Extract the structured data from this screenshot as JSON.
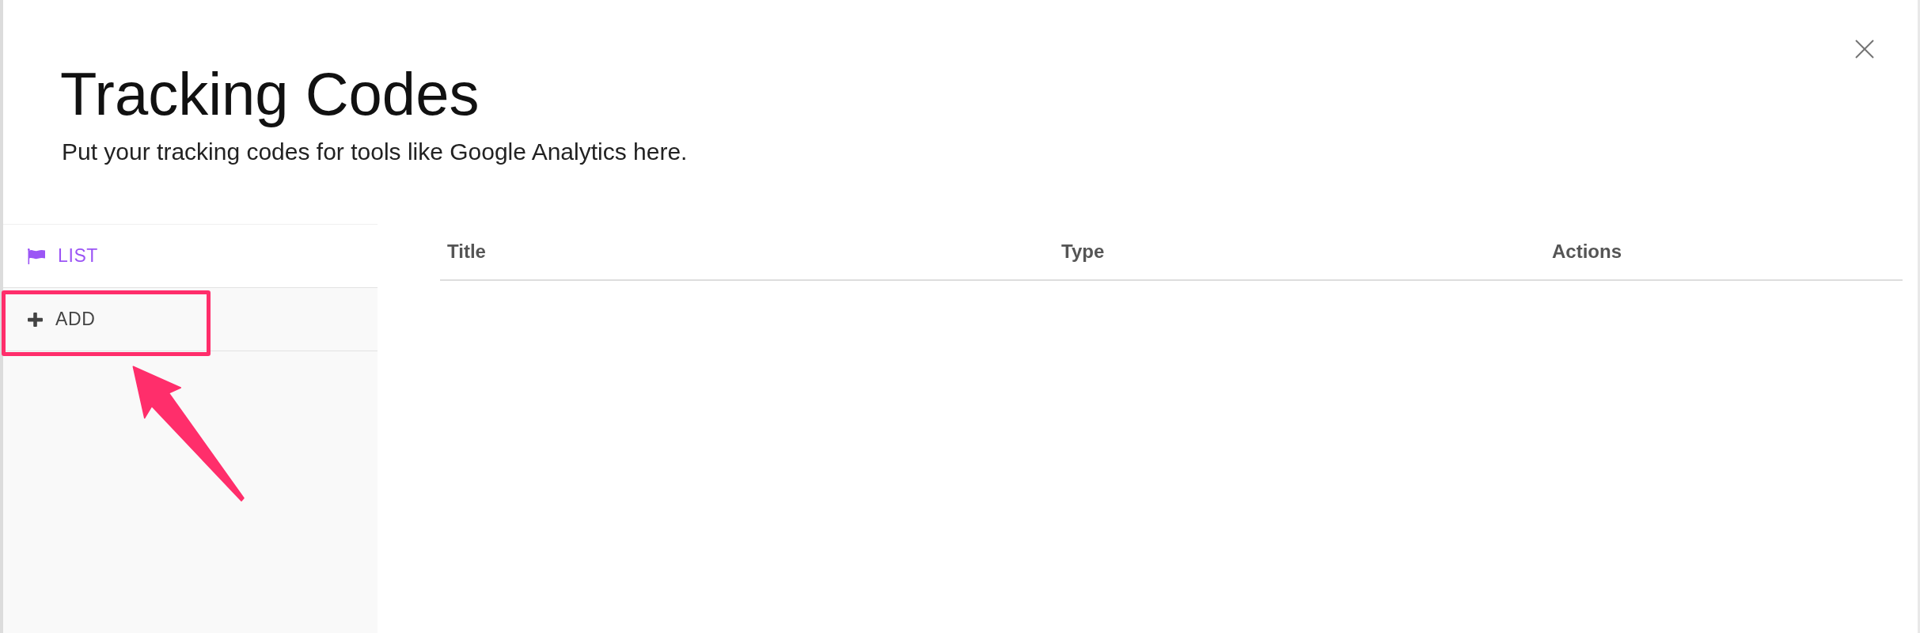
{
  "dialog": {
    "title": "Tracking Codes",
    "subtitle": "Put your tracking codes for tools like Google Analytics here."
  },
  "sidebar": {
    "items": [
      {
        "kind": "list",
        "label": "LIST",
        "selected": true,
        "highlighted": false
      },
      {
        "kind": "add",
        "label": "ADD",
        "selected": false,
        "highlighted": true
      }
    ]
  },
  "table": {
    "columns": [
      "Title",
      "Type",
      "Actions"
    ]
  }
}
